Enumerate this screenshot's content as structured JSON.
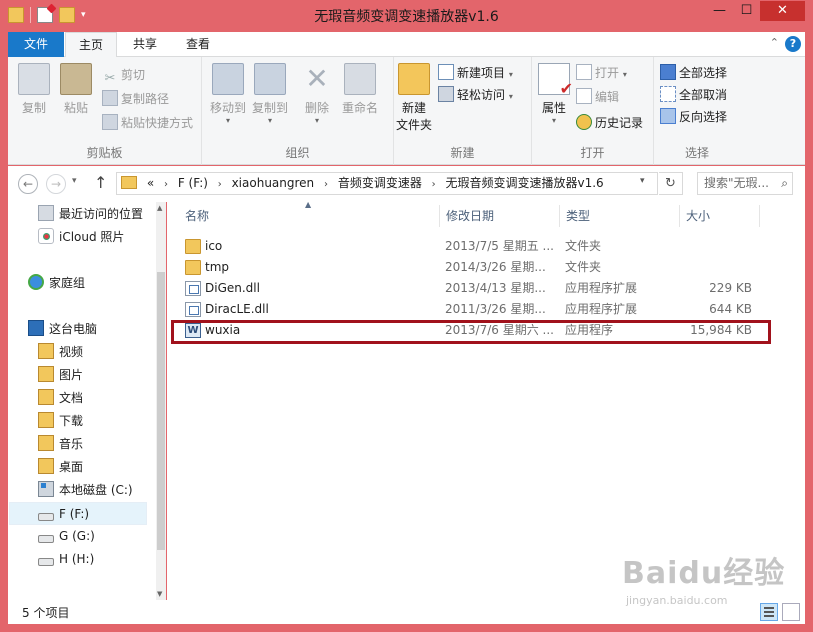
{
  "window": {
    "title": "无瑕音频变调变速播放器v1.6",
    "minimize": "—",
    "maximize": "☐",
    "close": "✕"
  },
  "tabs": [
    {
      "label": "文件"
    },
    {
      "label": "主页"
    },
    {
      "label": "共享"
    },
    {
      "label": "查看"
    }
  ],
  "ribbon": {
    "clipboard": {
      "label": "剪贴板",
      "copy": "复制",
      "paste": "粘贴",
      "cut": "剪切",
      "copy_path": "复制路径",
      "paste_shortcut": "粘贴快捷方式"
    },
    "organize": {
      "label": "组织",
      "move_to": "移动到",
      "copy_to": "复制到",
      "delete": "删除",
      "rename": "重命名"
    },
    "new": {
      "label": "新建",
      "new_folder_line1": "新建",
      "new_folder_line2": "文件夹",
      "new_item": "新建项目",
      "easy_access": "轻松访问"
    },
    "open": {
      "label": "打开",
      "properties": "属性",
      "open": "打开",
      "edit": "编辑",
      "history": "历史记录"
    },
    "select": {
      "label": "选择",
      "select_all": "全部选择",
      "select_none": "全部取消",
      "invert": "反向选择"
    }
  },
  "address": {
    "prefix": "«",
    "crumbs": [
      "F (F:)",
      "xiaohuangren",
      "音频变调变速器",
      "无瑕音频变调变速播放器v1.6"
    ],
    "search_placeholder": "搜索\"无瑕...",
    "search_icon": "search-icon"
  },
  "nav_pane": {
    "items": [
      {
        "label": "最近访问的位置",
        "icon": "recent-places-icon"
      },
      {
        "label": "iCloud 照片",
        "icon": "icloud-icon"
      },
      {
        "label": "家庭组",
        "icon": "homegroup-icon"
      },
      {
        "label": "这台电脑",
        "icon": "computer-icon"
      },
      {
        "label": "视频",
        "icon": "videos-folder-icon"
      },
      {
        "label": "图片",
        "icon": "pictures-folder-icon"
      },
      {
        "label": "文档",
        "icon": "documents-folder-icon"
      },
      {
        "label": "下载",
        "icon": "downloads-folder-icon"
      },
      {
        "label": "音乐",
        "icon": "music-folder-icon"
      },
      {
        "label": "桌面",
        "icon": "desktop-folder-icon"
      },
      {
        "label": "本地磁盘 (C:)",
        "icon": "local-disk-icon"
      },
      {
        "label": "F (F:)",
        "icon": "drive-icon"
      },
      {
        "label": "G (G:)",
        "icon": "drive-icon"
      },
      {
        "label": "H (H:)",
        "icon": "drive-icon"
      }
    ]
  },
  "columns": {
    "name": "名称",
    "date": "修改日期",
    "type": "类型",
    "size": "大小"
  },
  "files": [
    {
      "name": "ico",
      "date": "2013/7/5 星期五 ...",
      "type": "文件夹",
      "size": "",
      "icon": "folder-icon"
    },
    {
      "name": "tmp",
      "date": "2014/3/26 星期...",
      "type": "文件夹",
      "size": "",
      "icon": "folder-icon"
    },
    {
      "name": "DiGen.dll",
      "date": "2013/4/13 星期...",
      "type": "应用程序扩展",
      "size": "229 KB",
      "icon": "dll-icon"
    },
    {
      "name": "DiracLE.dll",
      "date": "2011/3/26 星期...",
      "type": "应用程序扩展",
      "size": "644 KB",
      "icon": "dll-icon"
    },
    {
      "name": "wuxia",
      "date": "2013/7/6 星期六 ...",
      "type": "应用程序",
      "size": "15,984 KB",
      "icon": "exe-icon"
    }
  ],
  "status": {
    "count": "5 个项目"
  },
  "watermark": {
    "brand": "Baidu经验",
    "url": "jingyan.baidu.com"
  },
  "colors": {
    "window_frame": "#e3656b",
    "file_tab": "#1979ca",
    "highlight_box": "#a1121c"
  }
}
